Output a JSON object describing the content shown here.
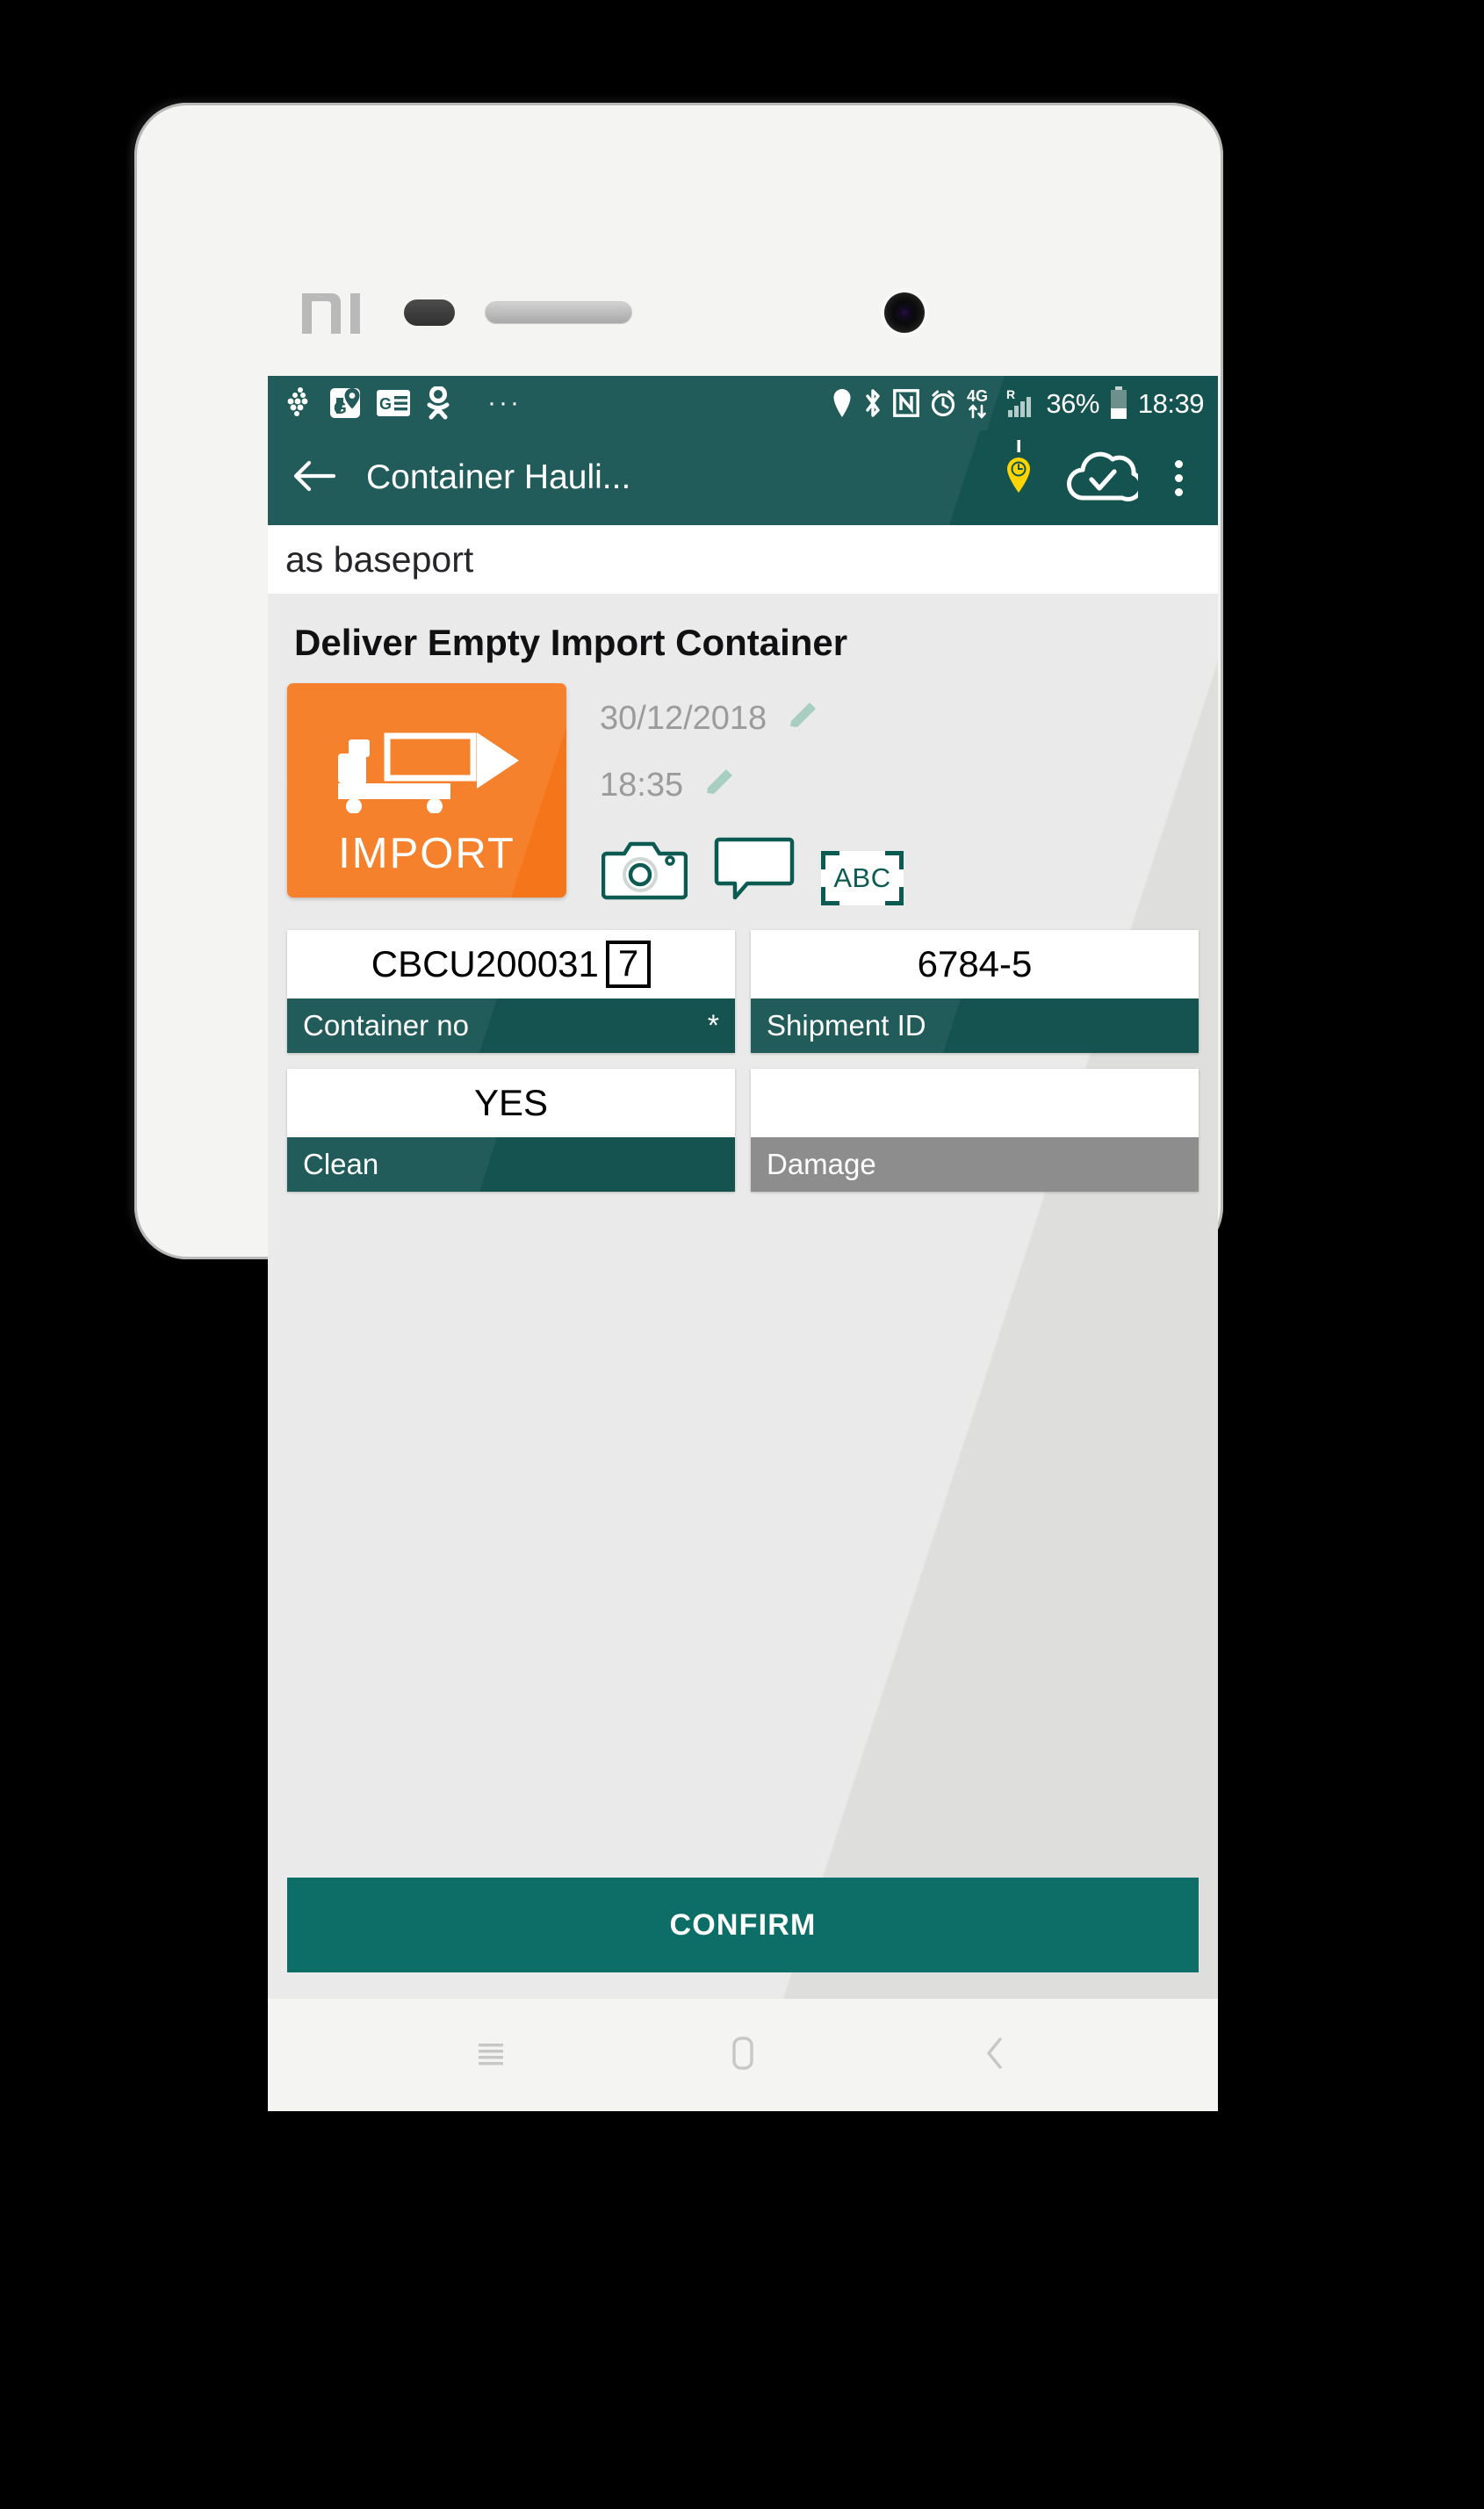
{
  "device": {
    "brand_logo": "mi-logo",
    "bezel_features": [
      "proximity-sensor",
      "earpiece-speaker",
      "front-camera"
    ]
  },
  "status_bar": {
    "notification_icons": [
      "dots-cluster-icon",
      "google-maps-icon",
      "google-news-icon",
      "odnoklassniki-icon"
    ],
    "overflow_dots": "···",
    "system_icons": [
      "location-icon",
      "bluetooth-icon",
      "nfc-icon",
      "alarm-icon",
      "data-4g-icon",
      "roaming-signal-icon"
    ],
    "battery_percent": "36%",
    "clock": "18:39"
  },
  "toolbar": {
    "back_icon": "arrow-left-icon",
    "title": "Container Hauli...",
    "pin_icon": "location-pin-icon",
    "cloud_icon": "cloud-check-icon",
    "overflow_icon": "more-vertical-icon"
  },
  "subheader": {
    "text": "as baseport"
  },
  "main": {
    "page_title": "Deliver Empty Import Container",
    "tile": {
      "label": "IMPORT",
      "icon": "truck-container-arrow-icon",
      "color": "#f5761a"
    },
    "meta": {
      "date": "30/12/2018",
      "time": "18:35",
      "date_edit_icon": "pencil-icon",
      "time_edit_icon": "pencil-icon"
    },
    "actions": [
      {
        "name": "camera-icon",
        "label": ""
      },
      {
        "name": "comment-icon",
        "label": ""
      },
      {
        "name": "scan-text-icon",
        "label": "ABC"
      }
    ],
    "fields": [
      {
        "label": "Container no",
        "value": "CBCU200031",
        "check_digit": "7",
        "required_marker": "*",
        "label_style": "teal"
      },
      {
        "label": "Shipment ID",
        "value": "6784-5",
        "check_digit": "",
        "required_marker": "",
        "label_style": "teal"
      },
      {
        "label": "Clean",
        "value": "YES",
        "check_digit": "",
        "required_marker": "",
        "label_style": "teal"
      },
      {
        "label": "Damage",
        "value": "",
        "check_digit": "",
        "required_marker": "",
        "label_style": "grey"
      }
    ],
    "confirm_label": "CONFIRM"
  },
  "nav_bar": {
    "recents_icon": "menu-icon",
    "home_icon": "home-square-icon",
    "back_icon": "chevron-left-icon"
  },
  "colors": {
    "primary_teal": "#155350",
    "confirm_teal": "#0d6e67",
    "accent_orange": "#f5761a",
    "pin_yellow": "#ffd400",
    "disabled_grey": "#8d8d8d",
    "content_bg": "#dededd"
  }
}
